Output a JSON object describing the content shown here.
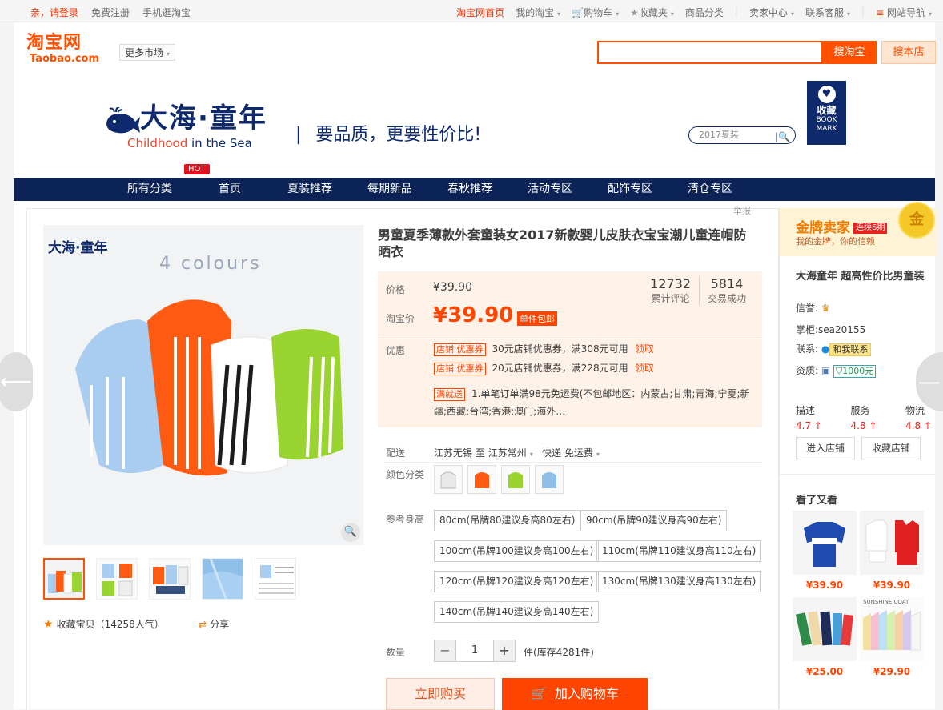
{
  "topbar": {
    "login": "亲，请登录",
    "register": "免费注册",
    "mobile": "手机逛淘宝",
    "home": "淘宝网首页",
    "my_taobao": "我的淘宝",
    "cart": "购物车",
    "favorites": "收藏夹",
    "categories": "商品分类",
    "seller": "卖家中心",
    "service": "联系客服",
    "sitenav": "网站导航"
  },
  "header": {
    "logo_cn": "淘宝网",
    "logo_en": "Taobao.com",
    "more_market": "更多市场",
    "search_button": "搜淘宝",
    "search_shop_button": "搜本店"
  },
  "banner": {
    "brand_name": "大海·童年",
    "brand_sub_a": "Childhood",
    "brand_sub_b": "in the Sea",
    "slogan": "要品质，更要性价比!",
    "search_placeholder": "2017夏装",
    "bookmark_cn": "收藏",
    "bookmark_en1": "BOOK",
    "bookmark_en2": "MARK"
  },
  "nav": {
    "hot_badge": "HOT",
    "items": [
      "所有分类",
      "首页",
      "夏装推荐",
      "每期新品",
      "春秋推荐",
      "活动专区",
      "配饰专区",
      "清仓专区"
    ]
  },
  "product": {
    "report": "举报",
    "title": "男童夏季薄款外套童装女2017新款婴儿皮肤衣宝宝潮儿童连帽防晒衣",
    "image_logo": "大海·童年",
    "image_caption": "4 colours",
    "price_label": "价格",
    "original_price": "¥39.90",
    "taobao_price_label": "淘宝价",
    "price": "¥39.90",
    "free_shipping_badge": "单件包邮",
    "reviews_count": "12732",
    "reviews_label": "累计评论",
    "sales_count": "5814",
    "sales_label": "交易成功",
    "promo_label": "优惠",
    "promos": [
      {
        "tag": "店铺 优惠券",
        "text": "30元店铺优惠券，满308元可用",
        "link": "领取"
      },
      {
        "tag": "店铺 优惠券",
        "text": "20元店铺优惠券，满228元可用",
        "link": "领取"
      },
      {
        "tag": "满就送",
        "text": "1.单笔订单满98元免运费(不包邮地区：内蒙古;甘肃;青海;宁夏;新疆;西藏;台湾;香港;澳门;海外…",
        "link": ""
      }
    ],
    "shipping_label": "配送",
    "ship_from": "江苏无锡",
    "ship_to_word": "至",
    "ship_to": "江苏常州",
    "ship_method": "快递 免运费",
    "color_label": "颜色分类",
    "size_label": "参考身高",
    "sizes": [
      "80cm(吊牌80建议身高80左右)",
      "90cm(吊牌90建议身高90左右)",
      "100cm(吊牌100建议身高100左右)",
      "110cm(吊牌110建议身高110左右)",
      "120cm(吊牌120建议身高120左右)",
      "130cm(吊牌130建议身高130左右)",
      "140cm(吊牌140建议身高140左右)"
    ],
    "qty_label": "数量",
    "qty_minus": "−",
    "qty_value": "1",
    "qty_plus": "+",
    "qty_unit": "件(库存4281件)",
    "buy_now": "立即购买",
    "add_to_cart": "加入购物车",
    "favorite_item": "收藏宝贝（14258人气）",
    "share": "分享"
  },
  "shop": {
    "gold_seller": "金牌卖家",
    "consecutive": "连续6期",
    "gold_sub": "我的金牌，你的信赖",
    "medal_text": "金",
    "name": "大海童年 超高性价比男童装",
    "credit_label": "信誉:",
    "manager_label": "掌柜:",
    "manager": "sea20155",
    "contact_label": "联系:",
    "contact_button": "和我联系",
    "qualification_label": "资质:",
    "deposit": "1000元",
    "ratings": [
      {
        "label": "描述",
        "score": "4.7"
      },
      {
        "label": "服务",
        "score": "4.8"
      },
      {
        "label": "物流",
        "score": "4.8"
      }
    ],
    "enter_shop": "进入店铺",
    "fav_shop": "收藏店铺",
    "see_also_title": "看了又看",
    "recommendations": [
      {
        "price": "¥39.90"
      },
      {
        "price": "¥39.90"
      },
      {
        "price": "¥25.00"
      },
      {
        "price": "¥29.90",
        "caption": "SUNSHINE COAT"
      }
    ]
  }
}
